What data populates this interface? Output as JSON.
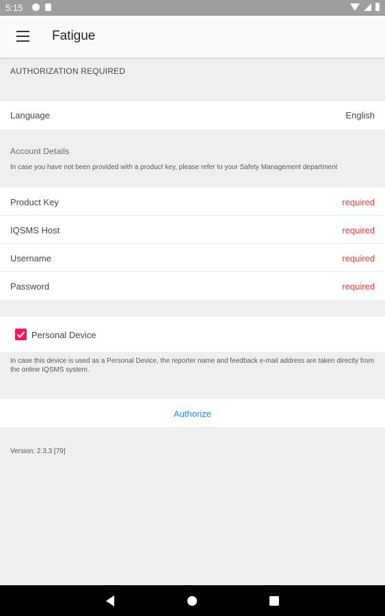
{
  "status_bar": {
    "time": "5:15"
  },
  "app_bar": {
    "title": "Fatigue"
  },
  "authorization_header": "AUTHORIZATION REQUIRED",
  "language": {
    "label": "Language",
    "value": "English"
  },
  "account": {
    "header": "Account Details",
    "note": "In case you have not been provided with a product key, please refer to your Safety Management department",
    "fields": [
      {
        "label": "Product Key",
        "value": "required"
      },
      {
        "label": "IQSMS Host",
        "value": "required"
      },
      {
        "label": "Username",
        "value": "required"
      },
      {
        "label": "Password",
        "value": "required"
      }
    ]
  },
  "personal_device": {
    "label": "Personal Device",
    "checked": true,
    "note": "In case this device is used as a Personal Device, the reporter name and feedback e-mail address are taken directly from the online IQSMS system."
  },
  "authorize_label": "Authorize",
  "version": "Version: 2.3.3 [79]",
  "colors": {
    "accent": "#e91e63",
    "required": "#e53935",
    "link": "#1e88e5"
  }
}
